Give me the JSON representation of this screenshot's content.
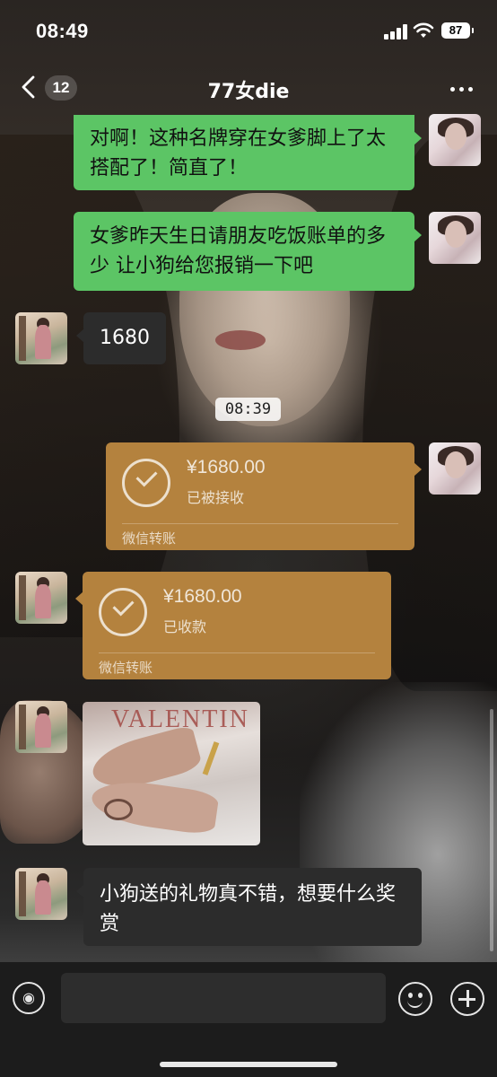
{
  "status_bar": {
    "time": "08:49",
    "battery": "87"
  },
  "nav": {
    "unread_count": "12",
    "title": "77女die"
  },
  "messages": [
    {
      "side": "self",
      "text": "对啊！这种名牌穿在女爹脚上了太搭配了！简直了！"
    },
    {
      "side": "self",
      "text": "女爹昨天生日请朋友吃饭账单的多少 让小狗给您报销一下吧"
    },
    {
      "side": "other",
      "text": "1680"
    },
    {
      "timestamp": "08:39"
    },
    {
      "side": "self",
      "type": "transfer",
      "amount": "¥1680.00",
      "status": "已被接收",
      "footer": "微信转账"
    },
    {
      "side": "other",
      "type": "transfer",
      "amount": "¥1680.00",
      "status": "已收款",
      "footer": "微信转账"
    },
    {
      "side": "other",
      "type": "image",
      "brand_text": "VALENTIN"
    },
    {
      "side": "other",
      "text": "小狗送的礼物真不错，想要什么奖赏"
    }
  ],
  "input_bar": {
    "voice_icon": "voice-icon",
    "emoji_icon": "emoji-icon",
    "plus_icon": "plus-icon"
  },
  "colors": {
    "self_bubble": "#5cc565",
    "other_bubble": "#2c2c2c",
    "transfer": "#b4823e"
  }
}
